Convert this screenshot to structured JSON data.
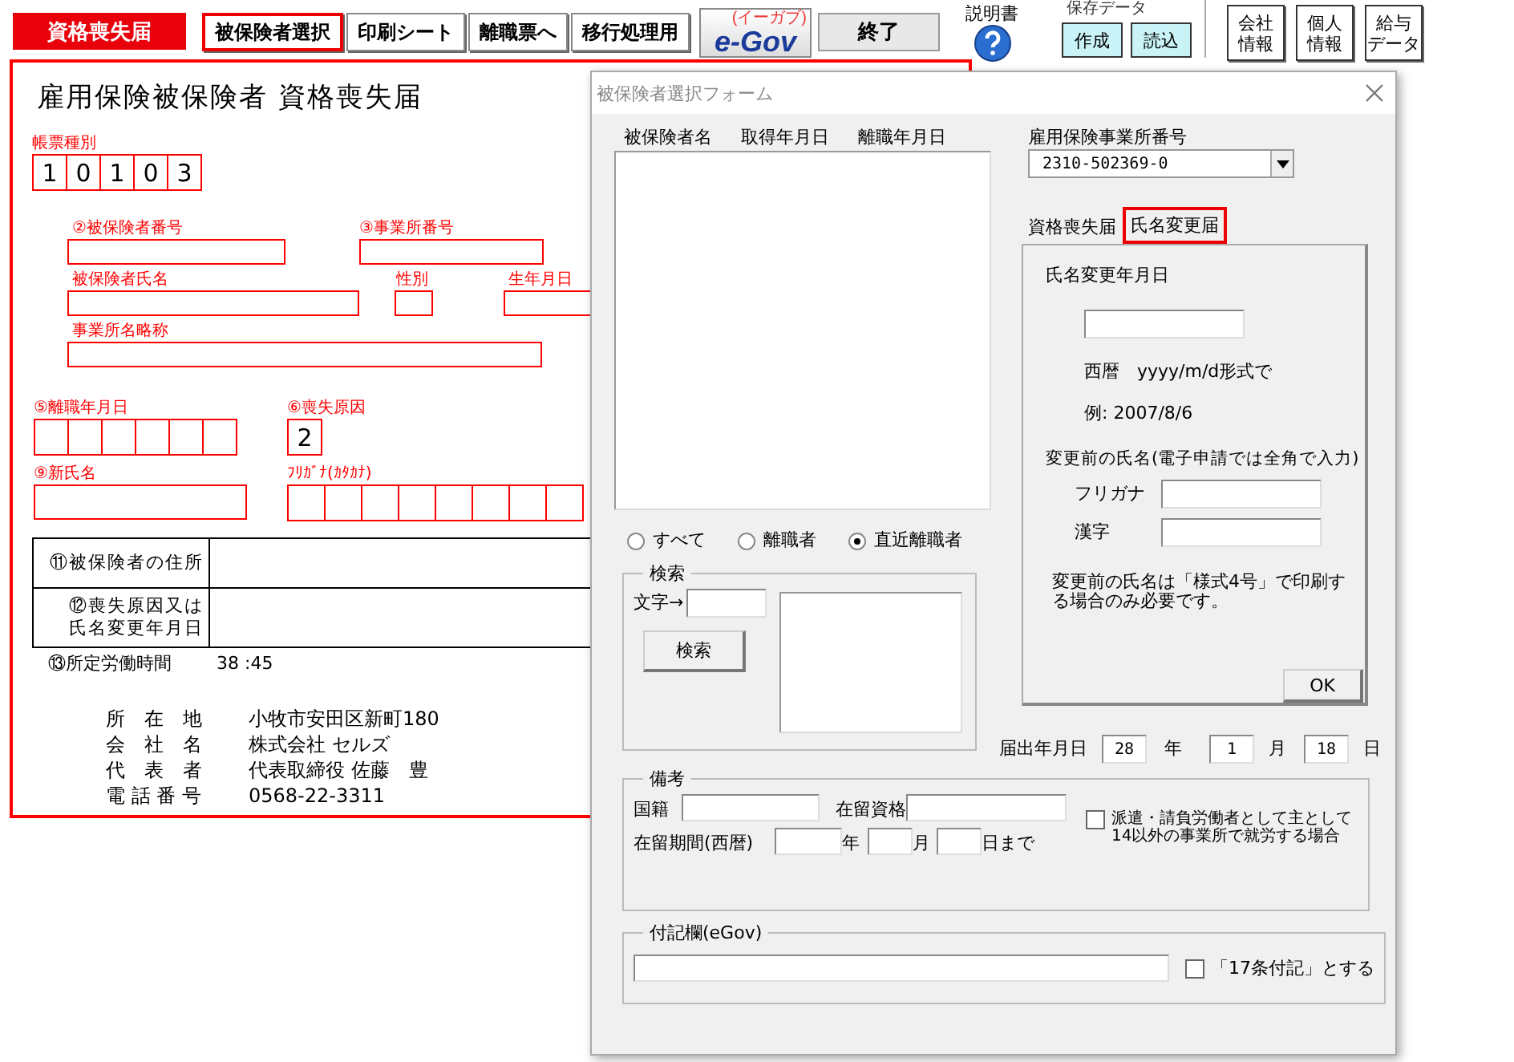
{
  "toolbar": {
    "title_button": "資格喪失届",
    "buttons": [
      {
        "label": "被保険者選択",
        "selected": true
      },
      {
        "label": "印刷シート",
        "selected": false
      },
      {
        "label": "離職票へ",
        "selected": false
      },
      {
        "label": "移行処理用",
        "selected": false
      }
    ],
    "egov": {
      "logo": "e-Gov",
      "sub": "(イーガブ)"
    },
    "exit": "終了",
    "manual": "説明書",
    "save_data": {
      "label": "保存データ",
      "buttons": [
        "作成",
        "読込"
      ]
    },
    "info_buttons": [
      {
        "lines": [
          "会社",
          "情報"
        ]
      },
      {
        "lines": [
          "個人",
          "情報"
        ]
      },
      {
        "lines": [
          "給与",
          "データ"
        ]
      }
    ]
  },
  "form": {
    "title": "雇用保険被保険者 資格喪失届",
    "form_type": {
      "label": "帳票種別",
      "digits": [
        "1",
        "0",
        "1",
        "0",
        "3"
      ]
    },
    "insured_number": "②被保険者番号",
    "office_number": "③事業所番号",
    "insured_name": "被保険者氏名",
    "sex": "性別",
    "birth_date": "生年月日",
    "office_short_name": "事業所名略称",
    "separation_date": "⑤離職年月日",
    "loss_reason": {
      "label": "⑥喪失原因",
      "value": "2"
    },
    "new_name": "⑨新氏名",
    "furigana": "ﾌﾘｶﾞﾅ(ｶﾀｶﾅ)",
    "table_rows": [
      {
        "lines": [
          "⑪被保険者の住所"
        ]
      },
      {
        "lines": [
          "⑫喪失原因又は",
          "氏名変更年月日"
        ]
      }
    ],
    "work_hours": {
      "label": "⑬所定労働時間",
      "value": "38 :45"
    },
    "company": [
      {
        "label": "所　在　地",
        "value": "小牧市安田区新町180"
      },
      {
        "label": "会　社　名",
        "value": "株式会社 セルズ"
      },
      {
        "label": "代　表　者",
        "value": "代表取締役 佐藤　豊"
      },
      {
        "label": "電 話 番 号",
        "value": "0568-22-3311"
      }
    ]
  },
  "dialog": {
    "title": "被保険者選択フォーム",
    "list_columns": [
      "被保険者名",
      "取得年月日",
      "離職年月日"
    ],
    "office_number": {
      "label": "雇用保険事業所番号",
      "value": "2310-502369-0"
    },
    "tabs": [
      {
        "label": "資格喪失届",
        "selected": false
      },
      {
        "label": "氏名変更届",
        "selected": true
      }
    ],
    "panel": {
      "date_label": "氏名変更年月日",
      "format_hint": "西暦　yyyy/m/d形式で",
      "example": "例: 2007/8/6",
      "prev_name_label": "変更前の氏名(電子申請では全角で入力)",
      "furigana_label": "フリガナ",
      "kanji_label": "漢字",
      "note": "変更前の氏名は「様式4号」で印刷する場合のみ必要です。",
      "ok": "OK"
    },
    "filters": [
      {
        "label": "すべて",
        "selected": false
      },
      {
        "label": "離職者",
        "selected": false
      },
      {
        "label": "直近離職者",
        "selected": true
      }
    ],
    "search": {
      "title": "検索",
      "char_label": "文字→",
      "button": "検索"
    },
    "filing_date": {
      "label": "届出年月日",
      "year": "28",
      "year_unit": "年",
      "month": "1",
      "month_unit": "月",
      "day": "18",
      "day_unit": "日"
    },
    "remarks": {
      "title": "備考",
      "nationality": "国籍",
      "status": "在留資格",
      "period": "在留期間(西暦)",
      "year_unit": "年",
      "month_unit": "月",
      "day_unit": "日まで",
      "dispatch": {
        "label": "派遣・請負労働者として主として14以外の事業所で就労する場合",
        "checked": false
      }
    },
    "notes": {
      "title": "付記欄(eGov)",
      "article17": {
        "label": "「17条付記」とする",
        "checked": false
      }
    }
  }
}
